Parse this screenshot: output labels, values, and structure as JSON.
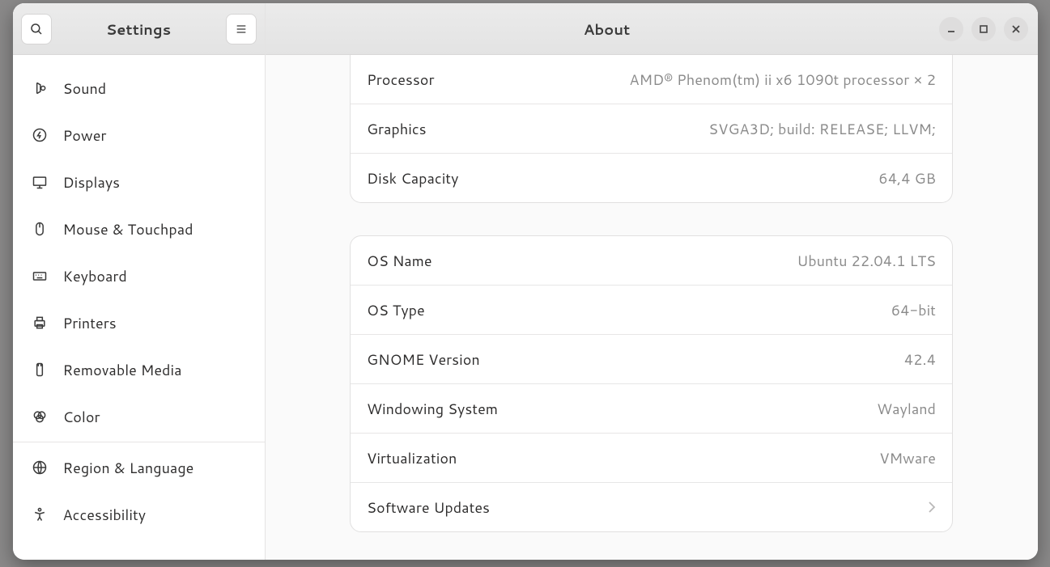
{
  "sidebar": {
    "title": "Settings",
    "items": [
      {
        "id": "sound",
        "label": "Sound"
      },
      {
        "id": "power",
        "label": "Power"
      },
      {
        "id": "displays",
        "label": "Displays"
      },
      {
        "id": "mouse",
        "label": "Mouse & Touchpad"
      },
      {
        "id": "keyboard",
        "label": "Keyboard"
      },
      {
        "id": "printers",
        "label": "Printers"
      },
      {
        "id": "removable",
        "label": "Removable Media"
      },
      {
        "id": "color",
        "label": "Color"
      },
      {
        "id": "region",
        "label": "Region & Language"
      },
      {
        "id": "accessibility",
        "label": "Accessibility"
      }
    ]
  },
  "header": {
    "title": "About"
  },
  "hardware_info": [
    {
      "label": "Processor",
      "value": "AMD® Phenom(tm) ii x6 1090t processor × 2"
    },
    {
      "label": "Graphics",
      "value": "SVGA3D; build: RELEASE; LLVM;"
    },
    {
      "label": "Disk Capacity",
      "value": "64,4 GB"
    }
  ],
  "os_info": [
    {
      "label": "OS Name",
      "value": "Ubuntu 22.04.1 LTS"
    },
    {
      "label": "OS Type",
      "value": "64-bit"
    },
    {
      "label": "GNOME Version",
      "value": "42.4"
    },
    {
      "label": "Windowing System",
      "value": "Wayland"
    },
    {
      "label": "Virtualization",
      "value": "VMware"
    },
    {
      "label": "Software Updates",
      "value": "",
      "clickable": true
    }
  ]
}
